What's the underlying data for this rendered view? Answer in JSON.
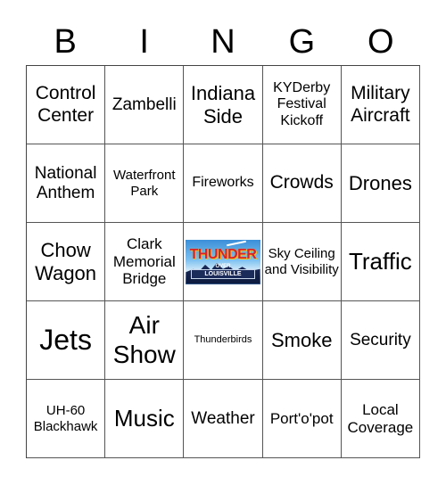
{
  "header": {
    "letters": [
      "B",
      "I",
      "N",
      "G",
      "O"
    ]
  },
  "board": {
    "rows": [
      [
        "Control Center",
        "Zambelli",
        "Indiana Side",
        "KYDerby Festival Kickoff",
        "Military Aircraft"
      ],
      [
        "National Anthem",
        "Waterfront Park",
        "Fireworks",
        "Crowds",
        "Drones"
      ],
      [
        "Chow Wagon",
        "Clark Memorial Bridge",
        "FREE",
        "Sky Ceiling and Visibility",
        "Traffic"
      ],
      [
        "Jets",
        "Air Show",
        "Thunderbirds",
        "Smoke",
        "Security"
      ],
      [
        "UH-60 Blackhawk",
        "Music",
        "Weather",
        "Port'o'pot",
        "Local Coverage"
      ]
    ],
    "free_space": {
      "title": "THUNDER",
      "subtitle": "OVER",
      "city": "LOUISVILLE"
    }
  }
}
